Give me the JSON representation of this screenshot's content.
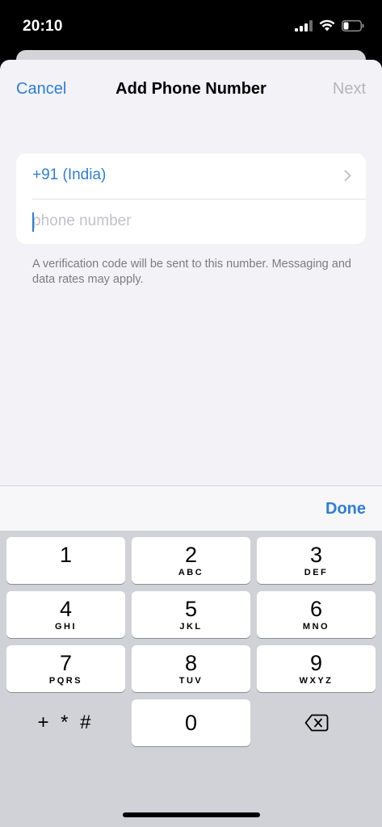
{
  "status_bar": {
    "time": "20:10",
    "icons": [
      "signal-icon",
      "wifi-icon",
      "battery-icon"
    ]
  },
  "nav": {
    "cancel_label": "Cancel",
    "title": "Add Phone Number",
    "next_label": "Next"
  },
  "form": {
    "country_value": "+91 (India)",
    "phone_value": "",
    "phone_placeholder": "phone number",
    "footnote": "A verification code will be sent to this number. Messaging and data rates may apply."
  },
  "keyboard": {
    "done_label": "Done",
    "keys": [
      {
        "digit": "1",
        "letters": ""
      },
      {
        "digit": "2",
        "letters": "ABC"
      },
      {
        "digit": "3",
        "letters": "DEF"
      },
      {
        "digit": "4",
        "letters": "GHI"
      },
      {
        "digit": "5",
        "letters": "JKL"
      },
      {
        "digit": "6",
        "letters": "MNO"
      },
      {
        "digit": "7",
        "letters": "PQRS"
      },
      {
        "digit": "8",
        "letters": "TUV"
      },
      {
        "digit": "9",
        "letters": "WXYZ"
      },
      {
        "digit": "0",
        "letters": ""
      }
    ],
    "symbols_label": "+ * #",
    "delete_icon": "delete-backspace-icon"
  },
  "colors": {
    "accent": "#2f7ed6",
    "disabled": "#b5b5ba",
    "sheet_background": "#f2f2f7",
    "keypad_background": "#d0d2d8"
  }
}
